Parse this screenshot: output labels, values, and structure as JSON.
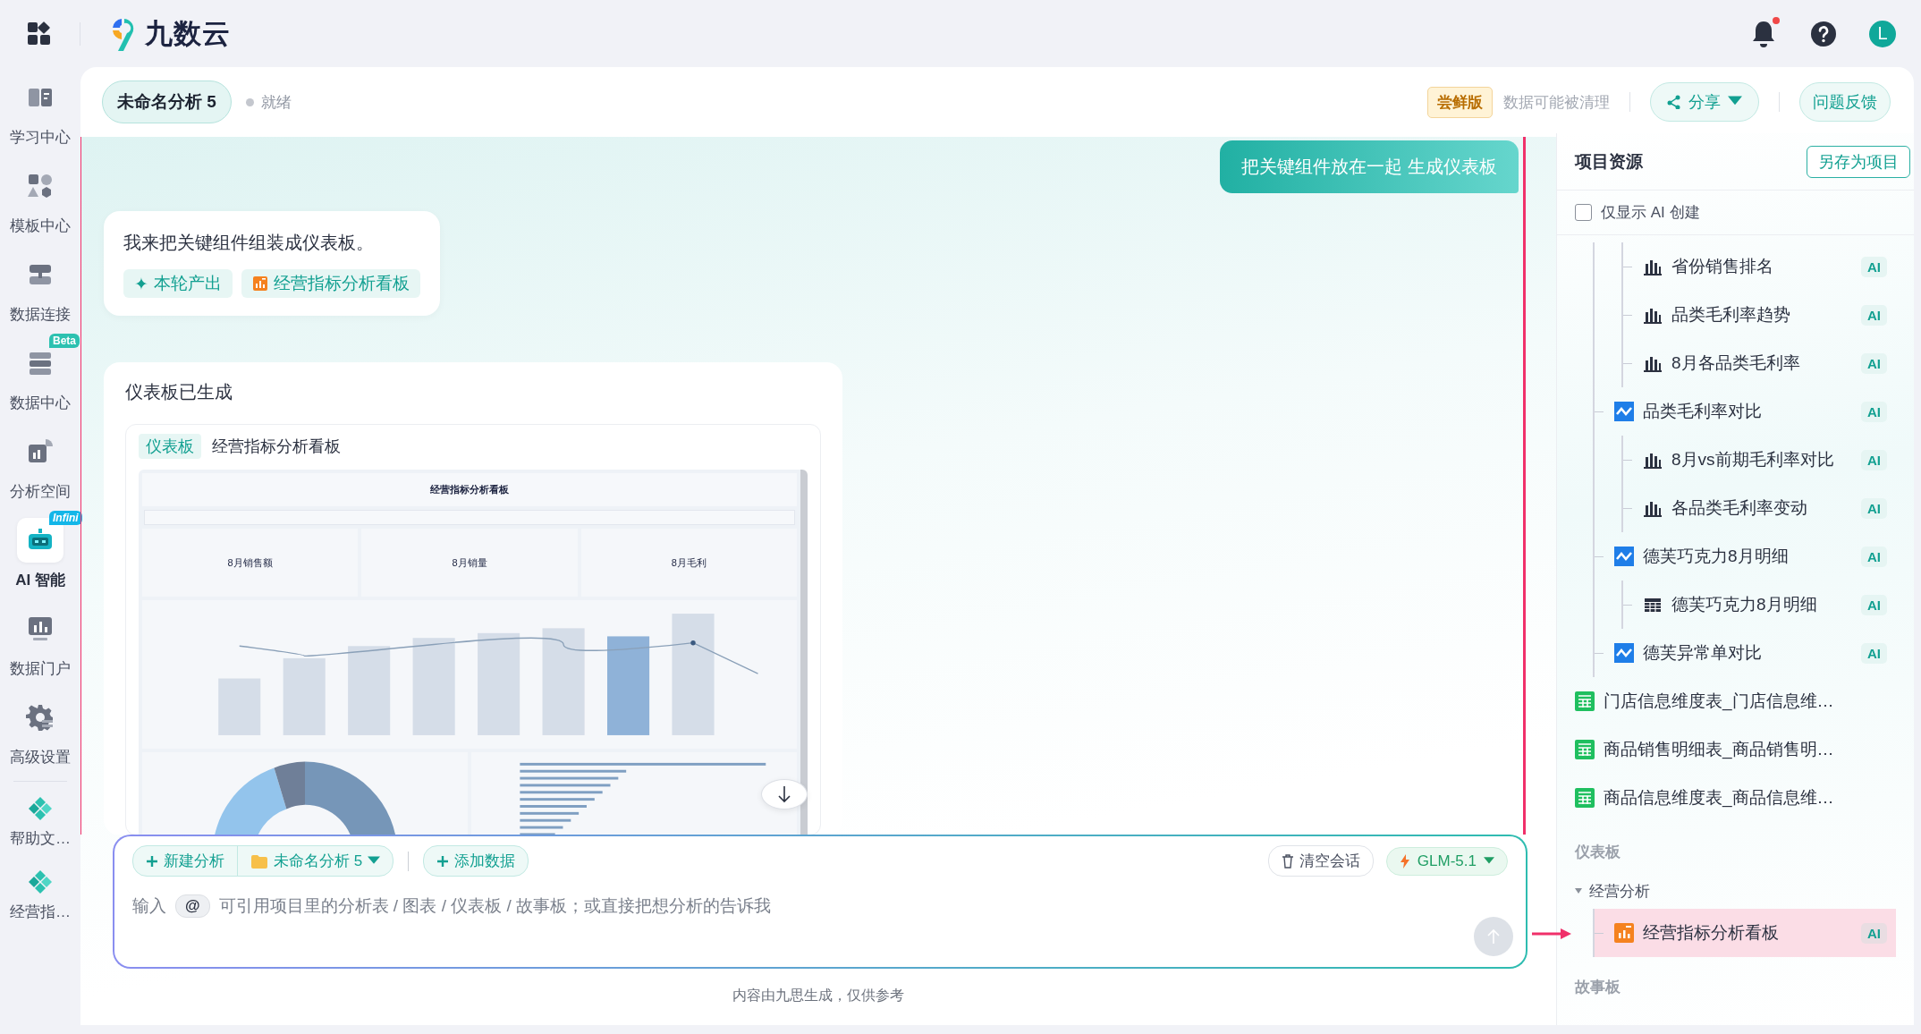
{
  "topbar": {
    "logo_text": "九数云",
    "has_unread": true,
    "avatar": "L"
  },
  "sidebar": {
    "items": [
      {
        "label": "学习中心",
        "selected": false
      },
      {
        "label": "模板中心",
        "selected": false
      },
      {
        "label": "数据连接",
        "selected": false
      },
      {
        "label": "数据中心",
        "selected": false,
        "badge": "Beta"
      },
      {
        "label": "分析空间",
        "selected": false
      },
      {
        "label": "AI 智能",
        "selected": true,
        "badge": "Infini"
      },
      {
        "label": "数据门户",
        "selected": false
      },
      {
        "label": "高级设置",
        "selected": false
      }
    ],
    "pinned": [
      {
        "label": "帮助文…"
      },
      {
        "label": "经营指…"
      }
    ]
  },
  "session": {
    "title": "未命名分析 5",
    "status": "就绪",
    "edition_badge": "尝鲜版",
    "notice": "数据可能被清理",
    "share": "分享",
    "feedback": "问题反馈"
  },
  "chat": {
    "messages": [
      {
        "kind": "user",
        "text": "把关键组件放在一起 生成仪表板"
      },
      {
        "kind": "assistant",
        "text": "我来把关键组件组装成仪表板。",
        "chips": [
          {
            "kind": "label",
            "icon": "✦",
            "text": "本轮产出"
          },
          {
            "kind": "dashboard",
            "text": "经营指标分析看板"
          }
        ]
      },
      {
        "kind": "result",
        "title": "仪表板已生成",
        "tag": "仪表板",
        "name": "经营指标分析看板",
        "preview": {
          "title": "经营指标分析看板",
          "kpis": [
            "8月销售额",
            "8月销量",
            "8月毛利"
          ]
        }
      }
    ]
  },
  "composer": {
    "new_analysis": "新建分析",
    "project": "未命名分析 5",
    "add_data": "添加数据",
    "clear": "清空会话",
    "model": "GLM-5.1",
    "prompt": "输入",
    "mention": "@",
    "hint": "可引用项目里的分析表 / 图表 / 仪表板 / 故事板；或直接把想分析的告诉我"
  },
  "disclaimer": "内容由九思生成，仅供参考",
  "resources": {
    "title": "项目资源",
    "save_button": "另存为项目",
    "filter": {
      "label": "仅显示 AI 创建",
      "checked": false
    },
    "tree": [
      {
        "kind": "group",
        "children": [
          {
            "kind": "group",
            "children": [
              {
                "kind": "bar",
                "label": "省份销售排名",
                "badge": "AI",
                "selected": false
              },
              {
                "kind": "bar",
                "label": "品类毛利率趋势",
                "badge": "AI",
                "selected": false
              },
              {
                "kind": "bar",
                "label": "8月各品类毛利率",
                "badge": "AI",
                "selected": false
              }
            ]
          },
          {
            "kind": "line",
            "label": "品类毛利率对比",
            "badge": "AI",
            "selected": false,
            "children": [
              {
                "kind": "bar",
                "label": "8月vs前期毛利率对比",
                "badge": "AI",
                "selected": false
              },
              {
                "kind": "bar",
                "label": "各品类毛利率变动",
                "badge": "AI",
                "selected": false
              }
            ]
          },
          {
            "kind": "line",
            "label": "德芙巧克力8月明细",
            "badge": "AI",
            "selected": false,
            "children": [
              {
                "kind": "table",
                "label": "德芙巧克力8月明细",
                "badge": "AI",
                "selected": false
              }
            ]
          },
          {
            "kind": "line",
            "label": "德芙异常单对比",
            "badge": "AI",
            "selected": false
          }
        ]
      },
      {
        "kind": "sheet",
        "label": "门店信息维度表_门店信息维…",
        "selected": false
      },
      {
        "kind": "sheet",
        "label": "商品销售明细表_商品销售明…",
        "selected": false
      },
      {
        "kind": "sheet",
        "label": "商品信息维度表_商品信息维…",
        "selected": false
      }
    ],
    "sections": [
      {
        "title": "仪表板",
        "groups": [
          {
            "label": "经营分析",
            "expanded": true,
            "children": [
              {
                "kind": "dashboard",
                "label": "经营指标分析看板",
                "badge": "AI",
                "selected": true
              }
            ]
          }
        ]
      },
      {
        "title": "故事板"
      }
    ]
  }
}
